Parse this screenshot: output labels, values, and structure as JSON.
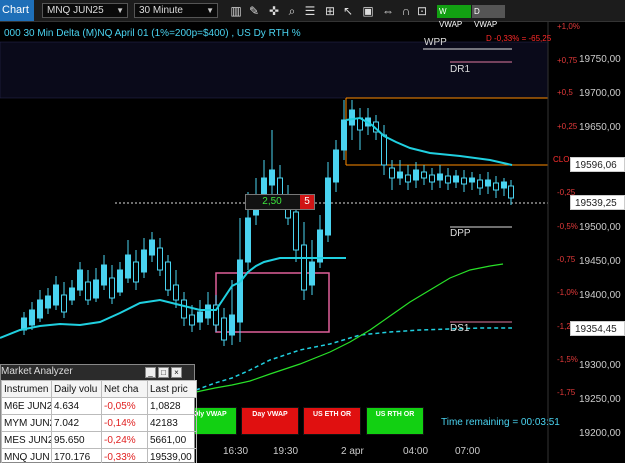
{
  "toolbar": {
    "tab_label": "Chart",
    "instrument": "MNQ JUN25",
    "timeframe": "30 Minute",
    "vwap_w": "W VWAP",
    "vwap_d": "D VWAP"
  },
  "chart": {
    "title": "000 30 Min Delta (M)NQ  April 01 (1%=200p=$400) , US Dy RTH %",
    "levels": {
      "wpp": "WPP",
      "dr1": "DR1",
      "dpp": "DPP",
      "ds1": "DS1"
    },
    "red_info": "D -0,33% = -65,25",
    "clo_label": "CLO",
    "position": {
      "value": "2,50",
      "quantity": "5"
    },
    "price_axis": [
      "19750,00",
      "19700,00",
      "19650,00",
      "19500,00",
      "19450,00",
      "19400,00",
      "19300,00",
      "19250,00",
      "19200,00"
    ],
    "pct_labels": [
      "+1,0%",
      "+0,75",
      "+0,5",
      "+0,25",
      "-0,25",
      "-0,5%",
      "-0,75",
      "-1,0%",
      "-1,25",
      "-1,5%",
      "-1,75"
    ],
    "price_boxes": {
      "close_ref": "19596,06",
      "last": "19539,25",
      "ds1": "19354,45"
    },
    "time_axis": [
      "16:30",
      "19:30",
      "2 apr",
      "04:00",
      "07:00"
    ],
    "time_remaining": "Time remaining = 00:03:51",
    "buttons": [
      {
        "label": "Dly VWAP",
        "color": "#12d012"
      },
      {
        "label": "Day VWAP",
        "color": "#e01010"
      },
      {
        "label": "US ETH OR",
        "color": "#e01010"
      },
      {
        "label": "US RTH OR",
        "color": "#12d012"
      }
    ],
    "colors": {
      "candle": "#4ad3f0",
      "vwap": "#20d0e0",
      "green_line": "#28e028",
      "level_orange": "#ff8c00",
      "box_pink": "#e0609a"
    }
  },
  "analyzer": {
    "title": "Market Analyzer",
    "columns": [
      "Instrumen",
      "Daily volu",
      "Net cha",
      "Last pric"
    ],
    "rows": [
      {
        "instrument": "M6E JUN2",
        "volume": "4.634",
        "net": "-0,05%",
        "last": "1,0828"
      },
      {
        "instrument": "MYM JUN2",
        "volume": "7.042",
        "net": "-0,14%",
        "last": "42183"
      },
      {
        "instrument": "MES JUN2",
        "volume": "95.650",
        "net": "-0,24%",
        "last": "5661,00"
      },
      {
        "instrument": "MNQ JUN",
        "volume": "170.176",
        "net": "-0,33%",
        "last": "19539,00"
      }
    ]
  }
}
